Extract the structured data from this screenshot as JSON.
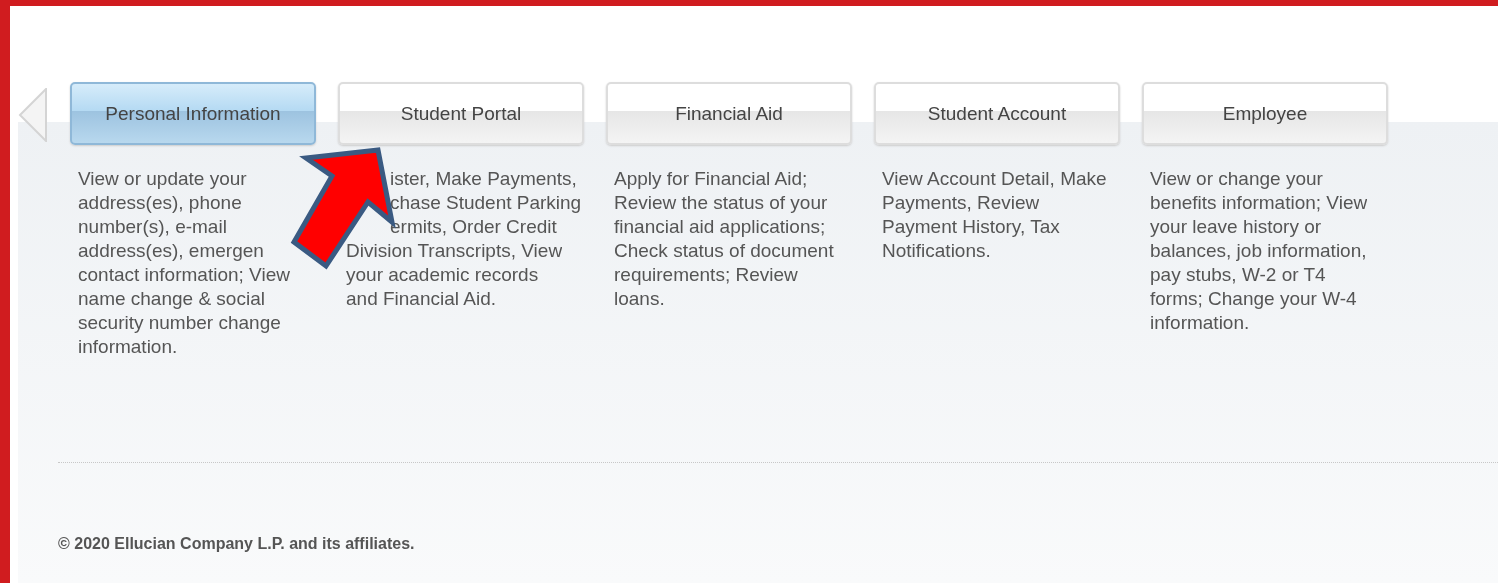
{
  "tabs": [
    {
      "label": "Personal Information",
      "selected": true,
      "arrow_pointer": false,
      "lines": [
        "View or update your",
        "address(es), phone",
        "number(s), e-mail",
        "address(es), emergen",
        "contact information; View",
        "name change & social",
        "security number change",
        "information."
      ]
    },
    {
      "label": "Student Portal",
      "selected": false,
      "arrow_pointer": true,
      "lines": [
        "ister, Make Payments,",
        "chase Student Parking",
        "ermits, Order Credit",
        "Division Transcripts, View",
        "your academic records",
        "and Financial Aid."
      ]
    },
    {
      "label": "Financial Aid",
      "selected": false,
      "arrow_pointer": false,
      "lines": [
        "Apply for Financial Aid;",
        "Review the status of your",
        "financial aid applications;",
        "Check status of document",
        "requirements; Review",
        "loans."
      ]
    },
    {
      "label": "Student Account",
      "selected": false,
      "arrow_pointer": false,
      "lines": [
        "View Account Detail, Make",
        "Payments, Review",
        "Payment History, Tax",
        "Notifications."
      ]
    },
    {
      "label": "Employee",
      "selected": false,
      "arrow_pointer": false,
      "lines": [
        "View or change your",
        "benefits information; View",
        "your leave history or",
        "balances, job information,",
        "pay stubs, W-2 or T4",
        "forms; Change your W-4",
        "information."
      ]
    }
  ],
  "footer": {
    "copyright": "© 2020 Ellucian Company L.P. and its affiliates."
  }
}
